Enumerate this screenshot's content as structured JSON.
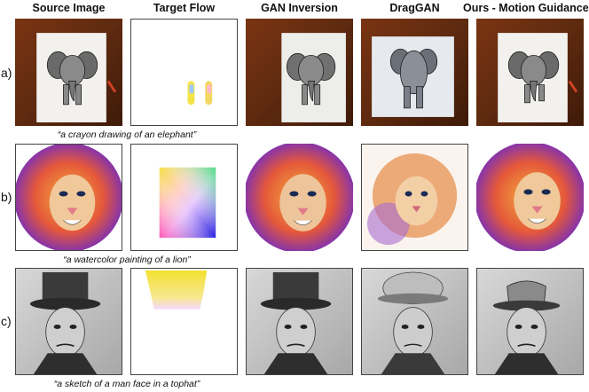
{
  "columns": [
    "Source Image",
    "Target Flow",
    "GAN Inversion",
    "DragGAN",
    "Ours - Motion Guidance"
  ],
  "rows": [
    {
      "label": "a)",
      "caption": "“a crayon drawing of an elephant”"
    },
    {
      "label": "b)",
      "caption": "“a watercolor painting of a lion”"
    },
    {
      "label": "c)",
      "caption": "“a sketch of a man face in a tophat”"
    }
  ]
}
